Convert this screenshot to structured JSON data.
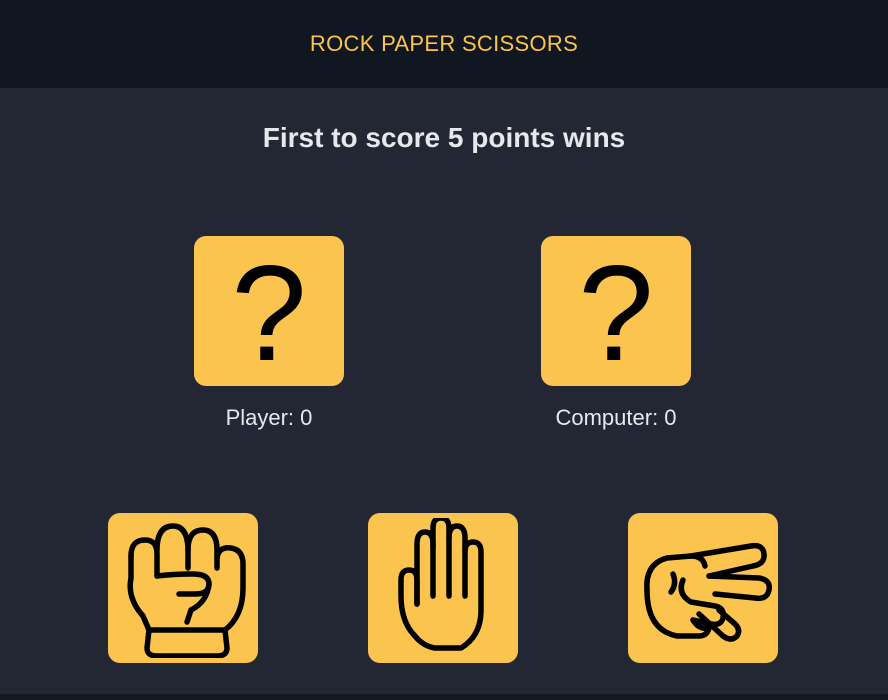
{
  "header": {
    "title": "ROCK PAPER SCISSORS"
  },
  "subtitle": "First to score 5 points wins",
  "player": {
    "label": "Player: 0",
    "choice_glyph": "?",
    "choice_icon": "question-mark-icon"
  },
  "computer": {
    "label": "Computer: 0",
    "choice_glyph": "?",
    "choice_icon": "question-mark-icon"
  },
  "choices": [
    {
      "name": "rock",
      "icon": "fist-icon"
    },
    {
      "name": "paper",
      "icon": "open-hand-icon"
    },
    {
      "name": "scissors",
      "icon": "scissors-hand-icon"
    }
  ],
  "colors": {
    "accent": "#fbc44f",
    "background": "#222733",
    "header_bg": "#111720",
    "text": "#e6e8ec"
  }
}
